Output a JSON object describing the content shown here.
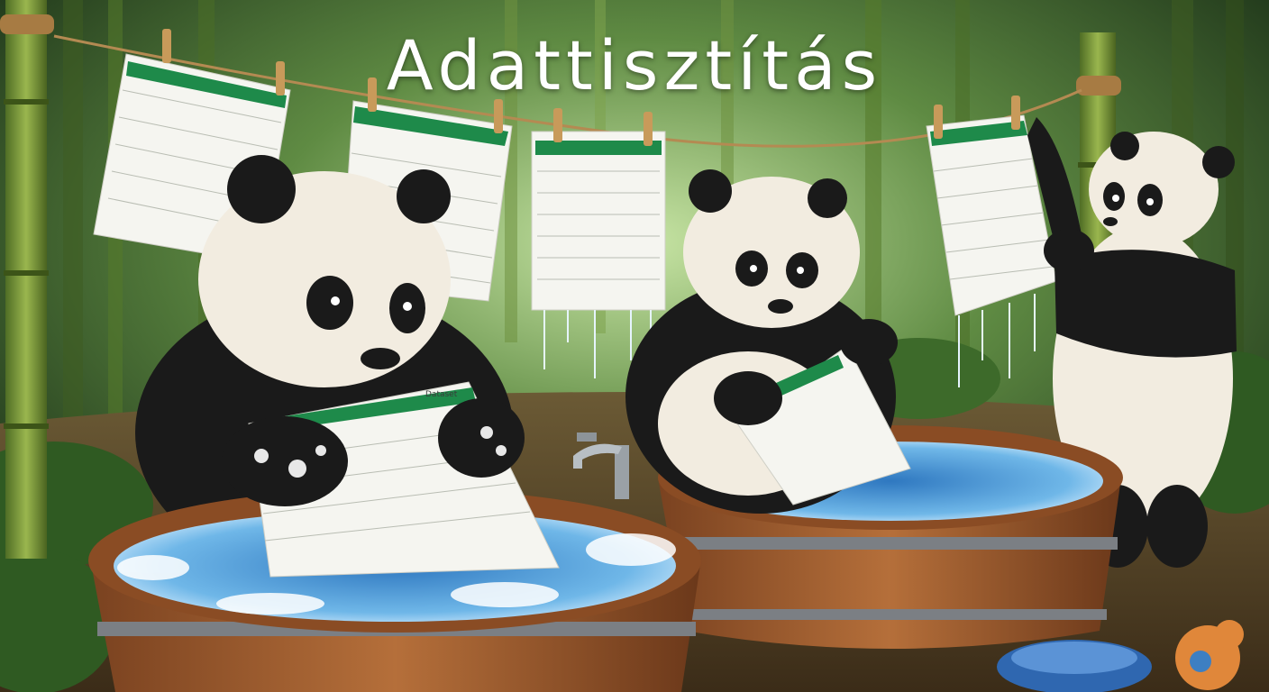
{
  "title": "Adattisztítás",
  "sheet_header": "Dataset",
  "colors": {
    "forest_dark": "#1f3a1c",
    "forest_light": "#a7c98a",
    "bamboo": "#7a9a3c",
    "wood": "#9a5a2e",
    "water": "#4f9ed8",
    "sheet_green": "#1e8a4a",
    "panda_white": "#f2ece0",
    "panda_black": "#1a1a1a",
    "title_text": "#ffffff"
  },
  "icons": [
    "panda-washing-icon",
    "panda-holding-sheet-icon",
    "panda-hanging-sheet-icon",
    "washtub-icon",
    "clothespin-icon",
    "faucet-icon",
    "blue-bowl-icon",
    "toy-icon"
  ]
}
